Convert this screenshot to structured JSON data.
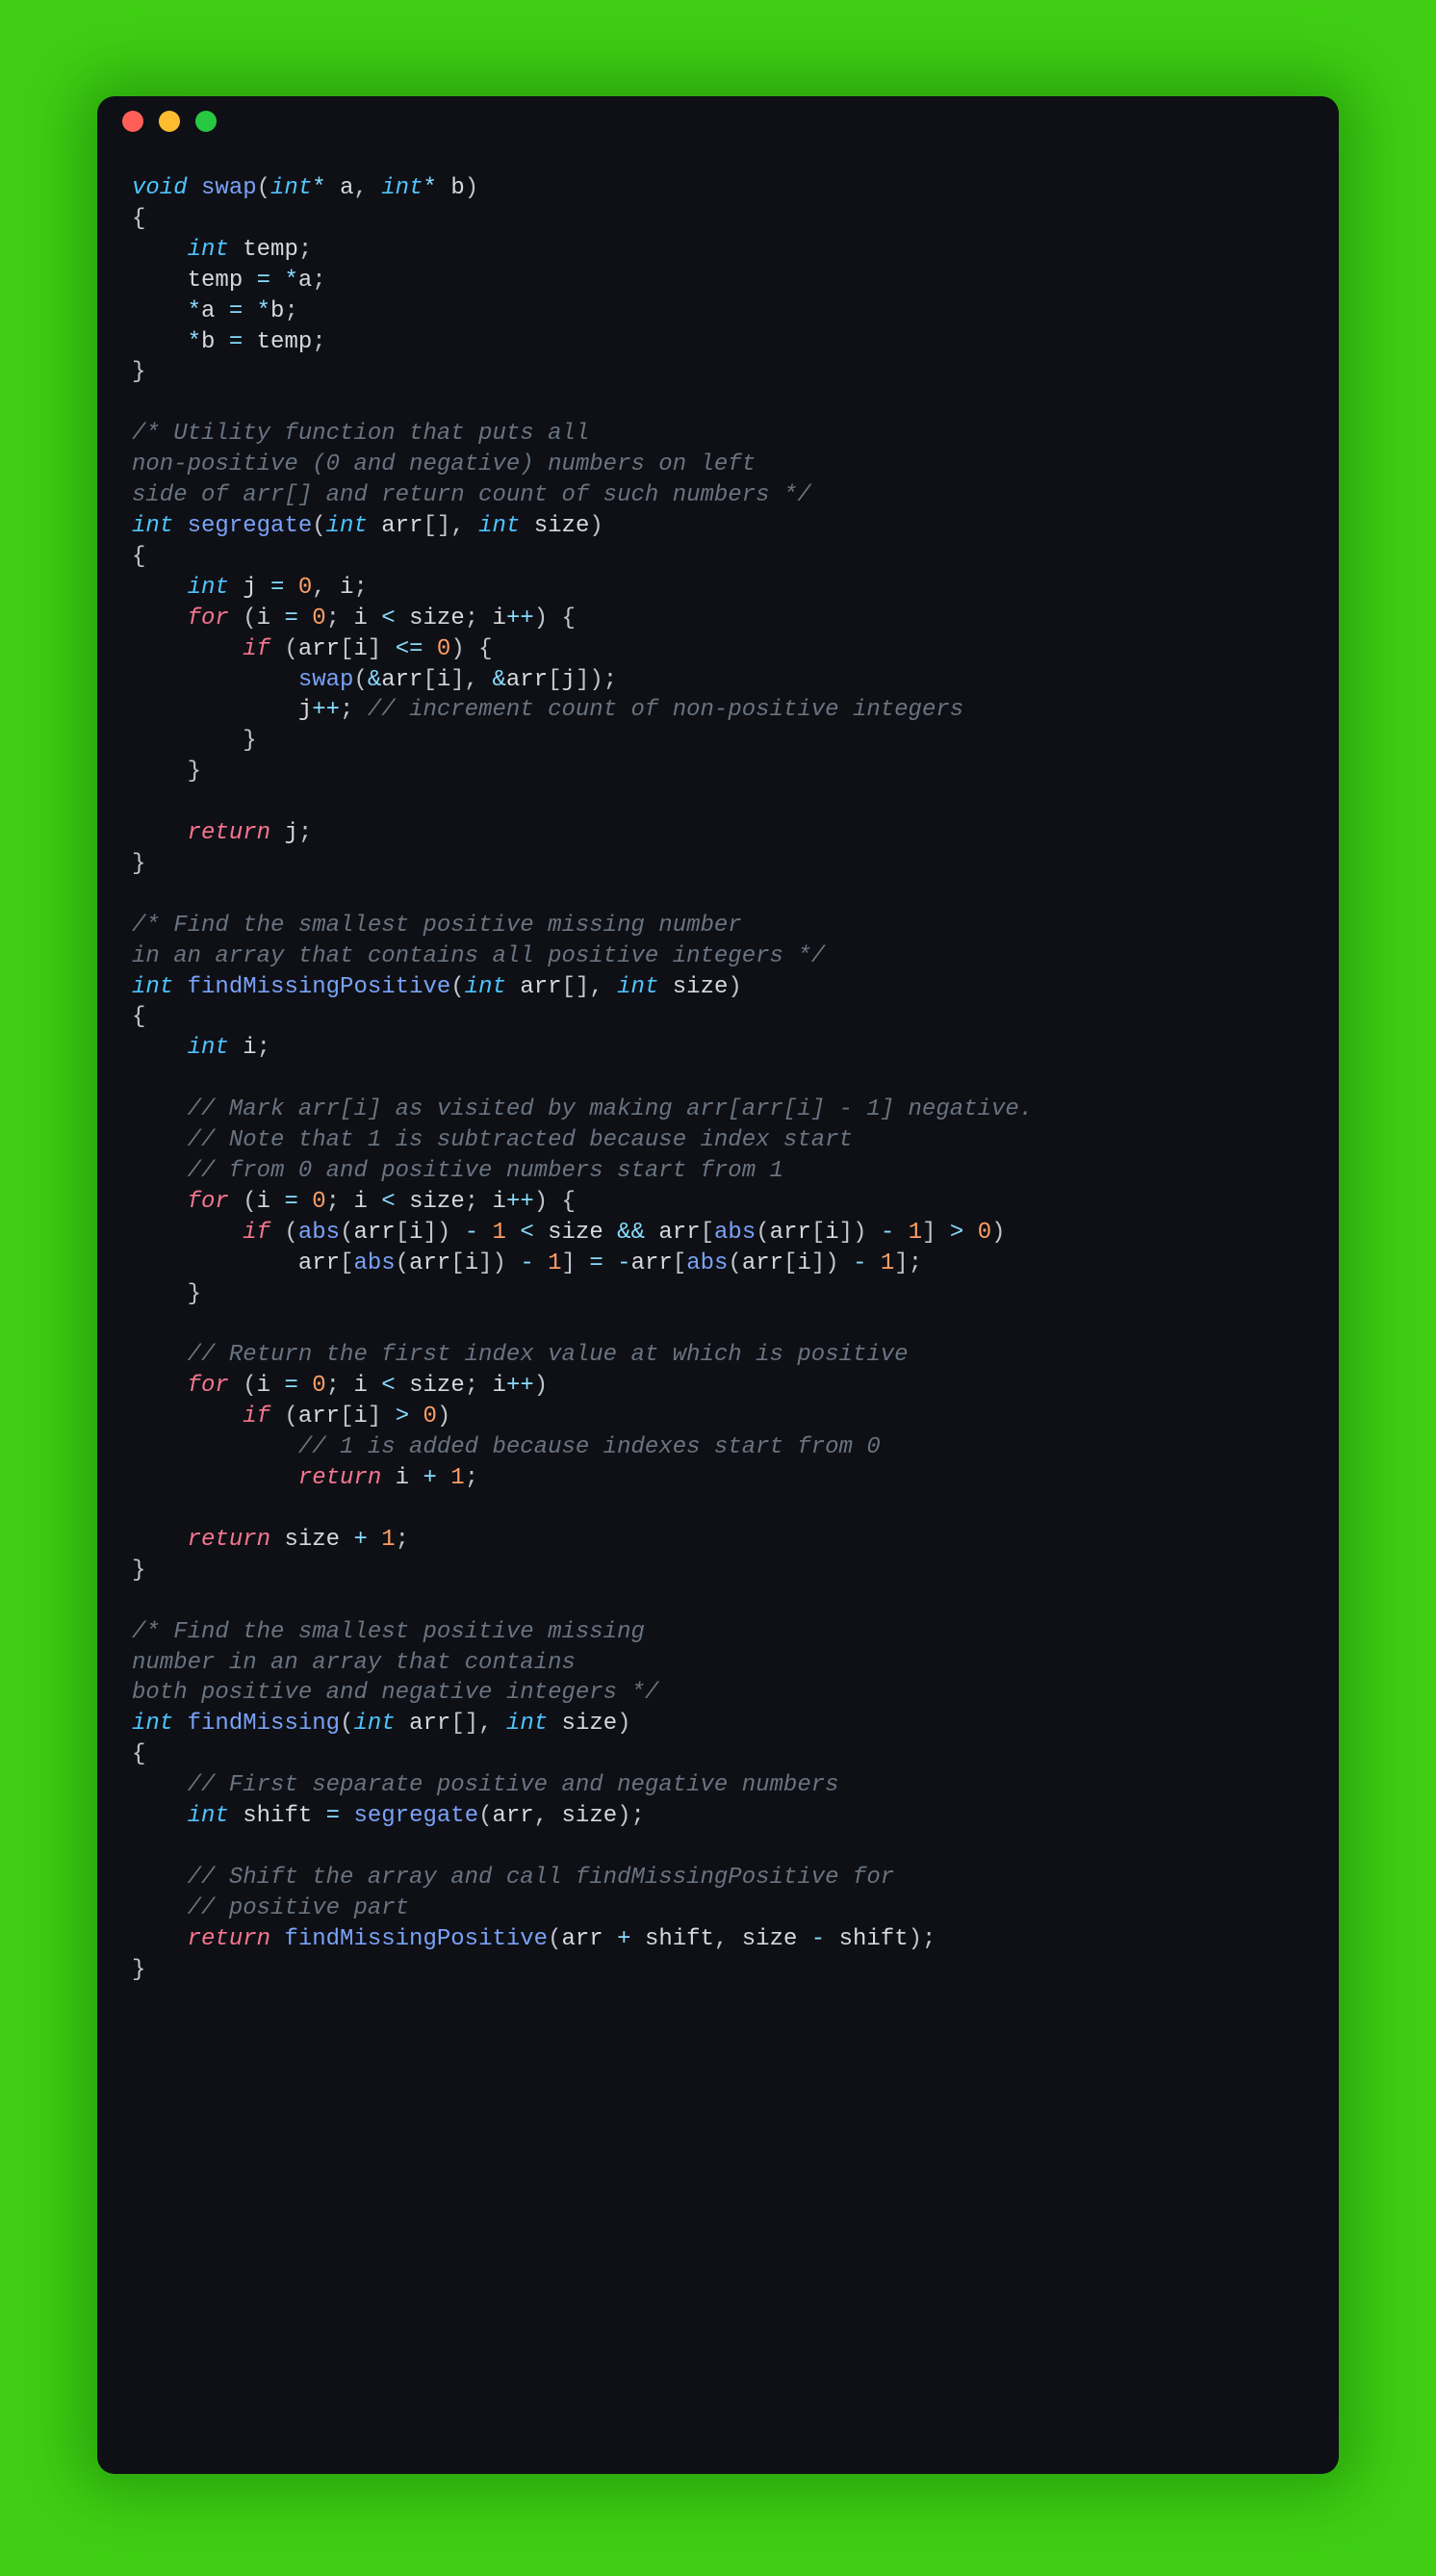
{
  "code": {
    "language": "c",
    "tokens": [
      [
        "kw",
        "void"
      ],
      [
        "pun",
        " "
      ],
      [
        "fn",
        "swap"
      ],
      [
        "pun",
        "("
      ],
      [
        "kw",
        "int"
      ],
      [
        "op",
        "*"
      ],
      [
        "pun",
        " "
      ],
      [
        "id",
        "a"
      ],
      [
        "pun",
        ", "
      ],
      [
        "kw",
        "int"
      ],
      [
        "op",
        "*"
      ],
      [
        "pun",
        " "
      ],
      [
        "id",
        "b"
      ],
      [
        "pun",
        ")"
      ],
      [
        "nl",
        ""
      ],
      [
        "pun",
        "{"
      ],
      [
        "nl",
        ""
      ],
      [
        "pun",
        "    "
      ],
      [
        "kw",
        "int"
      ],
      [
        "pun",
        " "
      ],
      [
        "id",
        "temp"
      ],
      [
        "pun",
        ";"
      ],
      [
        "nl",
        ""
      ],
      [
        "pun",
        "    "
      ],
      [
        "id",
        "temp"
      ],
      [
        "pun",
        " "
      ],
      [
        "op",
        "="
      ],
      [
        "pun",
        " "
      ],
      [
        "op",
        "*"
      ],
      [
        "id",
        "a"
      ],
      [
        "pun",
        ";"
      ],
      [
        "nl",
        ""
      ],
      [
        "pun",
        "    "
      ],
      [
        "op",
        "*"
      ],
      [
        "id",
        "a"
      ],
      [
        "pun",
        " "
      ],
      [
        "op",
        "="
      ],
      [
        "pun",
        " "
      ],
      [
        "op",
        "*"
      ],
      [
        "id",
        "b"
      ],
      [
        "pun",
        ";"
      ],
      [
        "nl",
        ""
      ],
      [
        "pun",
        "    "
      ],
      [
        "op",
        "*"
      ],
      [
        "id",
        "b"
      ],
      [
        "pun",
        " "
      ],
      [
        "op",
        "="
      ],
      [
        "pun",
        " "
      ],
      [
        "id",
        "temp"
      ],
      [
        "pun",
        ";"
      ],
      [
        "nl",
        ""
      ],
      [
        "pun",
        "}"
      ],
      [
        "nl",
        ""
      ],
      [
        "nl",
        ""
      ],
      [
        "cmt",
        "/* Utility function that puts all"
      ],
      [
        "nl",
        ""
      ],
      [
        "cmt",
        "non-positive (0 and negative) numbers on left"
      ],
      [
        "nl",
        ""
      ],
      [
        "cmt",
        "side of arr[] and return count of such numbers */"
      ],
      [
        "nl",
        ""
      ],
      [
        "kw",
        "int"
      ],
      [
        "pun",
        " "
      ],
      [
        "fn",
        "segregate"
      ],
      [
        "pun",
        "("
      ],
      [
        "kw",
        "int"
      ],
      [
        "pun",
        " "
      ],
      [
        "id",
        "arr"
      ],
      [
        "pun",
        "[], "
      ],
      [
        "kw",
        "int"
      ],
      [
        "pun",
        " "
      ],
      [
        "id",
        "size"
      ],
      [
        "pun",
        ")"
      ],
      [
        "nl",
        ""
      ],
      [
        "pun",
        "{"
      ],
      [
        "nl",
        ""
      ],
      [
        "pun",
        "    "
      ],
      [
        "kw",
        "int"
      ],
      [
        "pun",
        " "
      ],
      [
        "id",
        "j"
      ],
      [
        "pun",
        " "
      ],
      [
        "op",
        "="
      ],
      [
        "pun",
        " "
      ],
      [
        "num",
        "0"
      ],
      [
        "pun",
        ", "
      ],
      [
        "id",
        "i"
      ],
      [
        "pun",
        ";"
      ],
      [
        "nl",
        ""
      ],
      [
        "pun",
        "    "
      ],
      [
        "ctrl",
        "for"
      ],
      [
        "pun",
        " ("
      ],
      [
        "id",
        "i"
      ],
      [
        "pun",
        " "
      ],
      [
        "op",
        "="
      ],
      [
        "pun",
        " "
      ],
      [
        "num",
        "0"
      ],
      [
        "pun",
        "; "
      ],
      [
        "id",
        "i"
      ],
      [
        "pun",
        " "
      ],
      [
        "op",
        "<"
      ],
      [
        "pun",
        " "
      ],
      [
        "id",
        "size"
      ],
      [
        "pun",
        "; "
      ],
      [
        "id",
        "i"
      ],
      [
        "op",
        "++"
      ],
      [
        "pun",
        ") {"
      ],
      [
        "nl",
        ""
      ],
      [
        "pun",
        "        "
      ],
      [
        "ctrl",
        "if"
      ],
      [
        "pun",
        " ("
      ],
      [
        "id",
        "arr"
      ],
      [
        "pun",
        "["
      ],
      [
        "id",
        "i"
      ],
      [
        "pun",
        "] "
      ],
      [
        "op",
        "<="
      ],
      [
        "pun",
        " "
      ],
      [
        "num",
        "0"
      ],
      [
        "pun",
        ") {"
      ],
      [
        "nl",
        ""
      ],
      [
        "pun",
        "            "
      ],
      [
        "fn",
        "swap"
      ],
      [
        "pun",
        "("
      ],
      [
        "op",
        "&"
      ],
      [
        "id",
        "arr"
      ],
      [
        "pun",
        "["
      ],
      [
        "id",
        "i"
      ],
      [
        "pun",
        "], "
      ],
      [
        "op",
        "&"
      ],
      [
        "id",
        "arr"
      ],
      [
        "pun",
        "["
      ],
      [
        "id",
        "j"
      ],
      [
        "pun",
        "]);"
      ],
      [
        "nl",
        ""
      ],
      [
        "pun",
        "            "
      ],
      [
        "id",
        "j"
      ],
      [
        "op",
        "++"
      ],
      [
        "pun",
        "; "
      ],
      [
        "cmt",
        "// increment count of non-positive integers"
      ],
      [
        "nl",
        ""
      ],
      [
        "pun",
        "        }"
      ],
      [
        "nl",
        ""
      ],
      [
        "pun",
        "    }"
      ],
      [
        "nl",
        ""
      ],
      [
        "nl",
        ""
      ],
      [
        "pun",
        "    "
      ],
      [
        "ctrl",
        "return"
      ],
      [
        "pun",
        " "
      ],
      [
        "id",
        "j"
      ],
      [
        "pun",
        ";"
      ],
      [
        "nl",
        ""
      ],
      [
        "pun",
        "}"
      ],
      [
        "nl",
        ""
      ],
      [
        "nl",
        ""
      ],
      [
        "cmt",
        "/* Find the smallest positive missing number"
      ],
      [
        "nl",
        ""
      ],
      [
        "cmt",
        "in an array that contains all positive integers */"
      ],
      [
        "nl",
        ""
      ],
      [
        "kw",
        "int"
      ],
      [
        "pun",
        " "
      ],
      [
        "fn",
        "findMissingPositive"
      ],
      [
        "pun",
        "("
      ],
      [
        "kw",
        "int"
      ],
      [
        "pun",
        " "
      ],
      [
        "id",
        "arr"
      ],
      [
        "pun",
        "[], "
      ],
      [
        "kw",
        "int"
      ],
      [
        "pun",
        " "
      ],
      [
        "id",
        "size"
      ],
      [
        "pun",
        ")"
      ],
      [
        "nl",
        ""
      ],
      [
        "pun",
        "{"
      ],
      [
        "nl",
        ""
      ],
      [
        "pun",
        "    "
      ],
      [
        "kw",
        "int"
      ],
      [
        "pun",
        " "
      ],
      [
        "id",
        "i"
      ],
      [
        "pun",
        ";"
      ],
      [
        "nl",
        ""
      ],
      [
        "nl",
        ""
      ],
      [
        "pun",
        "    "
      ],
      [
        "cmt",
        "// Mark arr[i] as visited by making arr[arr[i] - 1] negative."
      ],
      [
        "nl",
        ""
      ],
      [
        "pun",
        "    "
      ],
      [
        "cmt",
        "// Note that 1 is subtracted because index start"
      ],
      [
        "nl",
        ""
      ],
      [
        "pun",
        "    "
      ],
      [
        "cmt",
        "// from 0 and positive numbers start from 1"
      ],
      [
        "nl",
        ""
      ],
      [
        "pun",
        "    "
      ],
      [
        "ctrl",
        "for"
      ],
      [
        "pun",
        " ("
      ],
      [
        "id",
        "i"
      ],
      [
        "pun",
        " "
      ],
      [
        "op",
        "="
      ],
      [
        "pun",
        " "
      ],
      [
        "num",
        "0"
      ],
      [
        "pun",
        "; "
      ],
      [
        "id",
        "i"
      ],
      [
        "pun",
        " "
      ],
      [
        "op",
        "<"
      ],
      [
        "pun",
        " "
      ],
      [
        "id",
        "size"
      ],
      [
        "pun",
        "; "
      ],
      [
        "id",
        "i"
      ],
      [
        "op",
        "++"
      ],
      [
        "pun",
        ") {"
      ],
      [
        "nl",
        ""
      ],
      [
        "pun",
        "        "
      ],
      [
        "ctrl",
        "if"
      ],
      [
        "pun",
        " ("
      ],
      [
        "fn",
        "abs"
      ],
      [
        "pun",
        "("
      ],
      [
        "id",
        "arr"
      ],
      [
        "pun",
        "["
      ],
      [
        "id",
        "i"
      ],
      [
        "pun",
        "]) "
      ],
      [
        "op",
        "-"
      ],
      [
        "pun",
        " "
      ],
      [
        "num",
        "1"
      ],
      [
        "pun",
        " "
      ],
      [
        "op",
        "<"
      ],
      [
        "pun",
        " "
      ],
      [
        "id",
        "size"
      ],
      [
        "pun",
        " "
      ],
      [
        "op",
        "&&"
      ],
      [
        "pun",
        " "
      ],
      [
        "id",
        "arr"
      ],
      [
        "pun",
        "["
      ],
      [
        "fn",
        "abs"
      ],
      [
        "pun",
        "("
      ],
      [
        "id",
        "arr"
      ],
      [
        "pun",
        "["
      ],
      [
        "id",
        "i"
      ],
      [
        "pun",
        "]) "
      ],
      [
        "op",
        "-"
      ],
      [
        "pun",
        " "
      ],
      [
        "num",
        "1"
      ],
      [
        "pun",
        "] "
      ],
      [
        "op",
        ">"
      ],
      [
        "pun",
        " "
      ],
      [
        "num",
        "0"
      ],
      [
        "pun",
        ")"
      ],
      [
        "nl",
        ""
      ],
      [
        "pun",
        "            "
      ],
      [
        "id",
        "arr"
      ],
      [
        "pun",
        "["
      ],
      [
        "fn",
        "abs"
      ],
      [
        "pun",
        "("
      ],
      [
        "id",
        "arr"
      ],
      [
        "pun",
        "["
      ],
      [
        "id",
        "i"
      ],
      [
        "pun",
        "]) "
      ],
      [
        "op",
        "-"
      ],
      [
        "pun",
        " "
      ],
      [
        "num",
        "1"
      ],
      [
        "pun",
        "] "
      ],
      [
        "op",
        "="
      ],
      [
        "pun",
        " "
      ],
      [
        "op",
        "-"
      ],
      [
        "id",
        "arr"
      ],
      [
        "pun",
        "["
      ],
      [
        "fn",
        "abs"
      ],
      [
        "pun",
        "("
      ],
      [
        "id",
        "arr"
      ],
      [
        "pun",
        "["
      ],
      [
        "id",
        "i"
      ],
      [
        "pun",
        "]) "
      ],
      [
        "op",
        "-"
      ],
      [
        "pun",
        " "
      ],
      [
        "num",
        "1"
      ],
      [
        "pun",
        "];"
      ],
      [
        "nl",
        ""
      ],
      [
        "pun",
        "    }"
      ],
      [
        "nl",
        ""
      ],
      [
        "nl",
        ""
      ],
      [
        "pun",
        "    "
      ],
      [
        "cmt",
        "// Return the first index value at which is positive"
      ],
      [
        "nl",
        ""
      ],
      [
        "pun",
        "    "
      ],
      [
        "ctrl",
        "for"
      ],
      [
        "pun",
        " ("
      ],
      [
        "id",
        "i"
      ],
      [
        "pun",
        " "
      ],
      [
        "op",
        "="
      ],
      [
        "pun",
        " "
      ],
      [
        "num",
        "0"
      ],
      [
        "pun",
        "; "
      ],
      [
        "id",
        "i"
      ],
      [
        "pun",
        " "
      ],
      [
        "op",
        "<"
      ],
      [
        "pun",
        " "
      ],
      [
        "id",
        "size"
      ],
      [
        "pun",
        "; "
      ],
      [
        "id",
        "i"
      ],
      [
        "op",
        "++"
      ],
      [
        "pun",
        ")"
      ],
      [
        "nl",
        ""
      ],
      [
        "pun",
        "        "
      ],
      [
        "ctrl",
        "if"
      ],
      [
        "pun",
        " ("
      ],
      [
        "id",
        "arr"
      ],
      [
        "pun",
        "["
      ],
      [
        "id",
        "i"
      ],
      [
        "pun",
        "] "
      ],
      [
        "op",
        ">"
      ],
      [
        "pun",
        " "
      ],
      [
        "num",
        "0"
      ],
      [
        "pun",
        ")"
      ],
      [
        "nl",
        ""
      ],
      [
        "pun",
        "            "
      ],
      [
        "cmt",
        "// 1 is added because indexes start from 0"
      ],
      [
        "nl",
        ""
      ],
      [
        "pun",
        "            "
      ],
      [
        "ctrl",
        "return"
      ],
      [
        "pun",
        " "
      ],
      [
        "id",
        "i"
      ],
      [
        "pun",
        " "
      ],
      [
        "op",
        "+"
      ],
      [
        "pun",
        " "
      ],
      [
        "num",
        "1"
      ],
      [
        "pun",
        ";"
      ],
      [
        "nl",
        ""
      ],
      [
        "nl",
        ""
      ],
      [
        "pun",
        "    "
      ],
      [
        "ctrl",
        "return"
      ],
      [
        "pun",
        " "
      ],
      [
        "id",
        "size"
      ],
      [
        "pun",
        " "
      ],
      [
        "op",
        "+"
      ],
      [
        "pun",
        " "
      ],
      [
        "num",
        "1"
      ],
      [
        "pun",
        ";"
      ],
      [
        "nl",
        ""
      ],
      [
        "pun",
        "}"
      ],
      [
        "nl",
        ""
      ],
      [
        "nl",
        ""
      ],
      [
        "cmt",
        "/* Find the smallest positive missing"
      ],
      [
        "nl",
        ""
      ],
      [
        "cmt",
        "number in an array that contains"
      ],
      [
        "nl",
        ""
      ],
      [
        "cmt",
        "both positive and negative integers */"
      ],
      [
        "nl",
        ""
      ],
      [
        "kw",
        "int"
      ],
      [
        "pun",
        " "
      ],
      [
        "fn",
        "findMissing"
      ],
      [
        "pun",
        "("
      ],
      [
        "kw",
        "int"
      ],
      [
        "pun",
        " "
      ],
      [
        "id",
        "arr"
      ],
      [
        "pun",
        "[], "
      ],
      [
        "kw",
        "int"
      ],
      [
        "pun",
        " "
      ],
      [
        "id",
        "size"
      ],
      [
        "pun",
        ")"
      ],
      [
        "nl",
        ""
      ],
      [
        "pun",
        "{"
      ],
      [
        "nl",
        ""
      ],
      [
        "pun",
        "    "
      ],
      [
        "cmt",
        "// First separate positive and negative numbers"
      ],
      [
        "nl",
        ""
      ],
      [
        "pun",
        "    "
      ],
      [
        "kw",
        "int"
      ],
      [
        "pun",
        " "
      ],
      [
        "id",
        "shift"
      ],
      [
        "pun",
        " "
      ],
      [
        "op",
        "="
      ],
      [
        "pun",
        " "
      ],
      [
        "fn",
        "segregate"
      ],
      [
        "pun",
        "("
      ],
      [
        "id",
        "arr"
      ],
      [
        "pun",
        ", "
      ],
      [
        "id",
        "size"
      ],
      [
        "pun",
        ");"
      ],
      [
        "nl",
        ""
      ],
      [
        "nl",
        ""
      ],
      [
        "pun",
        "    "
      ],
      [
        "cmt",
        "// Shift the array and call findMissingPositive for"
      ],
      [
        "nl",
        ""
      ],
      [
        "pun",
        "    "
      ],
      [
        "cmt",
        "// positive part"
      ],
      [
        "nl",
        ""
      ],
      [
        "pun",
        "    "
      ],
      [
        "ctrl",
        "return"
      ],
      [
        "pun",
        " "
      ],
      [
        "fn",
        "findMissingPositive"
      ],
      [
        "pun",
        "("
      ],
      [
        "id",
        "arr"
      ],
      [
        "pun",
        " "
      ],
      [
        "op",
        "+"
      ],
      [
        "pun",
        " "
      ],
      [
        "id",
        "shift"
      ],
      [
        "pun",
        ", "
      ],
      [
        "id",
        "size"
      ],
      [
        "pun",
        " "
      ],
      [
        "op",
        "-"
      ],
      [
        "pun",
        " "
      ],
      [
        "id",
        "shift"
      ],
      [
        "pun",
        ");"
      ],
      [
        "nl",
        ""
      ],
      [
        "pun",
        "}"
      ],
      [
        "nl",
        ""
      ]
    ]
  }
}
